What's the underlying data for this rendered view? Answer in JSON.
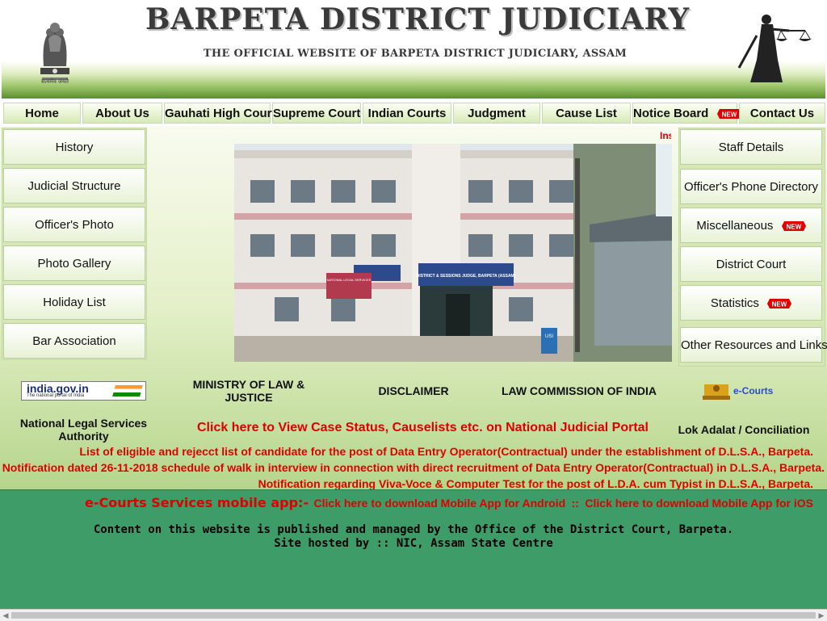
{
  "header": {
    "title": "BARPETA DISTRICT JUDICIARY",
    "subtitle": "THE OFFICIAL WEBSITE OF BARPETA DISTRICT JUDICIARY, ASSAM",
    "emblem_caption": "सत्यमेव जयते"
  },
  "nav": {
    "items": [
      {
        "label": "Home"
      },
      {
        "label": "About Us"
      },
      {
        "label": "Gauhati High Court"
      },
      {
        "label": "Supreme Court"
      },
      {
        "label": "Indian Courts"
      },
      {
        "label": "Judgment"
      },
      {
        "label": "Cause List"
      },
      {
        "label": "Notice Board",
        "new": true
      },
      {
        "label": "Contact Us"
      }
    ],
    "new_badge": "NEW"
  },
  "left_menu": {
    "items": [
      "History",
      "Judicial Structure",
      "Officer's Photo",
      "Photo Gallery",
      "Holiday List",
      "Bar Association"
    ]
  },
  "right_menu": {
    "items": [
      "Staff Details",
      "Officer's Phone Directory",
      "Miscellaneous",
      "District Court",
      "Statistics",
      "Other Resources and Links"
    ]
  },
  "marquee": {
    "text": "Ins"
  },
  "photo": {
    "sign_main": "DISTRICT & SESSIONS JUDGE, BARPETA (ASSAM)",
    "sign_left": "NATIONAL LEGAL SERVICES",
    "sign_door": "USI"
  },
  "links": {
    "india_gov": "india.gov.in",
    "india_gov_tagline": "The national portal of India",
    "ministry": "MINISTRY OF LAW & JUSTICE",
    "disclaimer": "DISCLAIMER",
    "law_commission": "LAW COMMISSION OF INDIA",
    "ecourts_logo": "e-Courts",
    "nalsa": "National Legal Services Authority",
    "njp": "Click here to View Case Status, Causelists etc. on National Judicial Portal",
    "lok_adalat": "Lok Adalat / Conciliation"
  },
  "notices": [
    "List of eligible and rejecct list of candidate for the post of Data Entry Operator(Contractual) under the establishment of D.L.S.A., Barpeta.",
    "Notification dated 26-11-2018 schedule of walk in interview in connection with direct recruitment of Data Entry Operator(Contractual) in D.L.S.A., Barpeta.",
    "Notification regarding Viva-Voce & Computer Test for the post of L.D.A. cum Typist in D.L.S.A., Barpeta."
  ],
  "footer": {
    "app_label": "e-Courts Services mobile app:-",
    "android": "Click here to download Mobile App for Android",
    "separator": "::",
    "ios": "Click here to download Mobile App for iOS",
    "line1": "Content on this website is published and managed by the Office of the District Court, Barpeta.",
    "line2": "Site hosted by :: NIC, Assam State Centre"
  },
  "colors": {
    "accent_green": "#5c8f2c",
    "footer_green": "#3e9c68",
    "notice_red": "#e00000"
  }
}
